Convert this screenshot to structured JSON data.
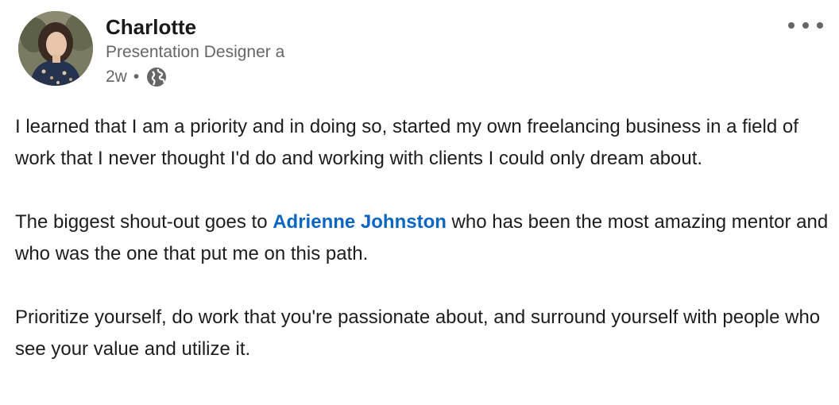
{
  "author": {
    "name": "Charlotte",
    "headline": "Presentation Designer a",
    "time": "2w",
    "separator": "•",
    "visibility_icon": "globe-icon"
  },
  "menu": {
    "icon": "more-options-icon"
  },
  "post": {
    "p1": "I learned that I am a priority and in doing so, started my own freelancing business in a field of work that I never thought I'd do and working with clients I could only dream about.",
    "p2_before": "The biggest shout-out goes to ",
    "mention": "Adrienne Johnston",
    "p2_after": " who has been the most amazing mentor and who was the one that put me on this path.",
    "p3": "Prioritize yourself, do work that you're passionate about, and surround yourself with people who see your value and utilize it."
  },
  "colors": {
    "mention": "#0a66c2",
    "secondary_text": "#666666",
    "primary_text": "#1d1d1d"
  }
}
